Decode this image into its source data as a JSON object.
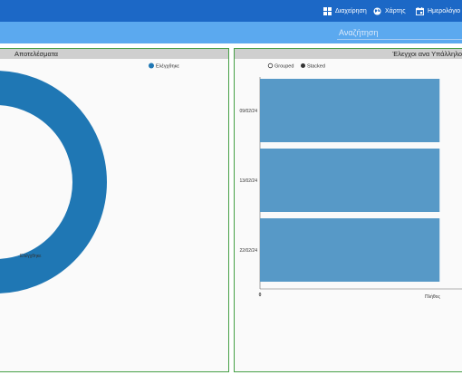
{
  "nav": {
    "management_label": "Διαχείρηση",
    "maps_label": "Χάρτης",
    "calendar_label": "Ημερολόγιο"
  },
  "search": {
    "placeholder": "Αναζήτηση"
  },
  "left_panel": {
    "title": "Αποτελέσματα"
  },
  "right_panel": {
    "title": "Έλεγχοι ανα Υπάλληλο"
  },
  "colors": {
    "nav": "#1c68c6",
    "search_bar": "#5ba9ef",
    "donut": "#1f77b4",
    "bars": "#5799c7",
    "panel_border": "#46a046"
  },
  "chart_data": [
    {
      "type": "pie",
      "donut": true,
      "categories": [
        "Ελέγχθηκε"
      ],
      "values": [
        1
      ],
      "legend": [
        "Ελέγχθηκε"
      ],
      "slice_labels": [
        "Ελέγχθηκε"
      ]
    },
    {
      "type": "bar",
      "orientation": "horizontal",
      "controls": [
        "Grouped",
        "Stacked"
      ],
      "selected_control": "Stacked",
      "categories": [
        "09/02/24",
        "13/02/24",
        "22/02/24"
      ],
      "values": [
        1,
        1,
        1
      ],
      "x_ticks": [
        "0"
      ],
      "xlabel_partial": "Πλήθος",
      "xlim": [
        0,
        1.15
      ]
    }
  ]
}
